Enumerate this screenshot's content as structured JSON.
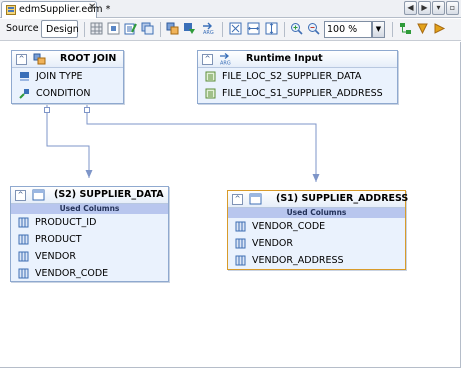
{
  "tab": {
    "title": "edmSupplier.edm *",
    "close": "✕"
  },
  "nav": {
    "back": "◀",
    "forward": "▶",
    "menu": "▾",
    "maximize": "▫"
  },
  "toolbar": {
    "source_label": "Source",
    "design_label": "Design",
    "zoom_value": "100 %",
    "zoom_dropdown": "▼"
  },
  "nodes": {
    "root_join": {
      "title": "ROOT JOIN",
      "collapse": "^",
      "rows": [
        "JOIN TYPE",
        "CONDITION"
      ]
    },
    "runtime_input": {
      "title": "Runtime Input",
      "collapse": "^",
      "rows": [
        "FILE_LOC_S2_SUPPLIER_DATA",
        "FILE_LOC_S1_SUPPLIER_ADDRESS"
      ]
    },
    "supplier_data": {
      "title": "(S2) SUPPLIER_DATA",
      "collapse": "^",
      "subheader": "Used Columns",
      "rows": [
        "PRODUCT_ID",
        "PRODUCT",
        "VENDOR",
        "VENDOR_CODE"
      ]
    },
    "supplier_address": {
      "title": "(S1) SUPPLIER_ADDRESS",
      "collapse": "^",
      "subheader": "Used Columns",
      "rows": [
        "VENDOR_CODE",
        "VENDOR",
        "VENDOR_ADDRESS"
      ]
    }
  },
  "colors": {
    "wire": "#7e95c8",
    "node_bg": "#eaf2fd",
    "selected_border": "#d89b2a",
    "subheader": "#b8c6ee"
  }
}
